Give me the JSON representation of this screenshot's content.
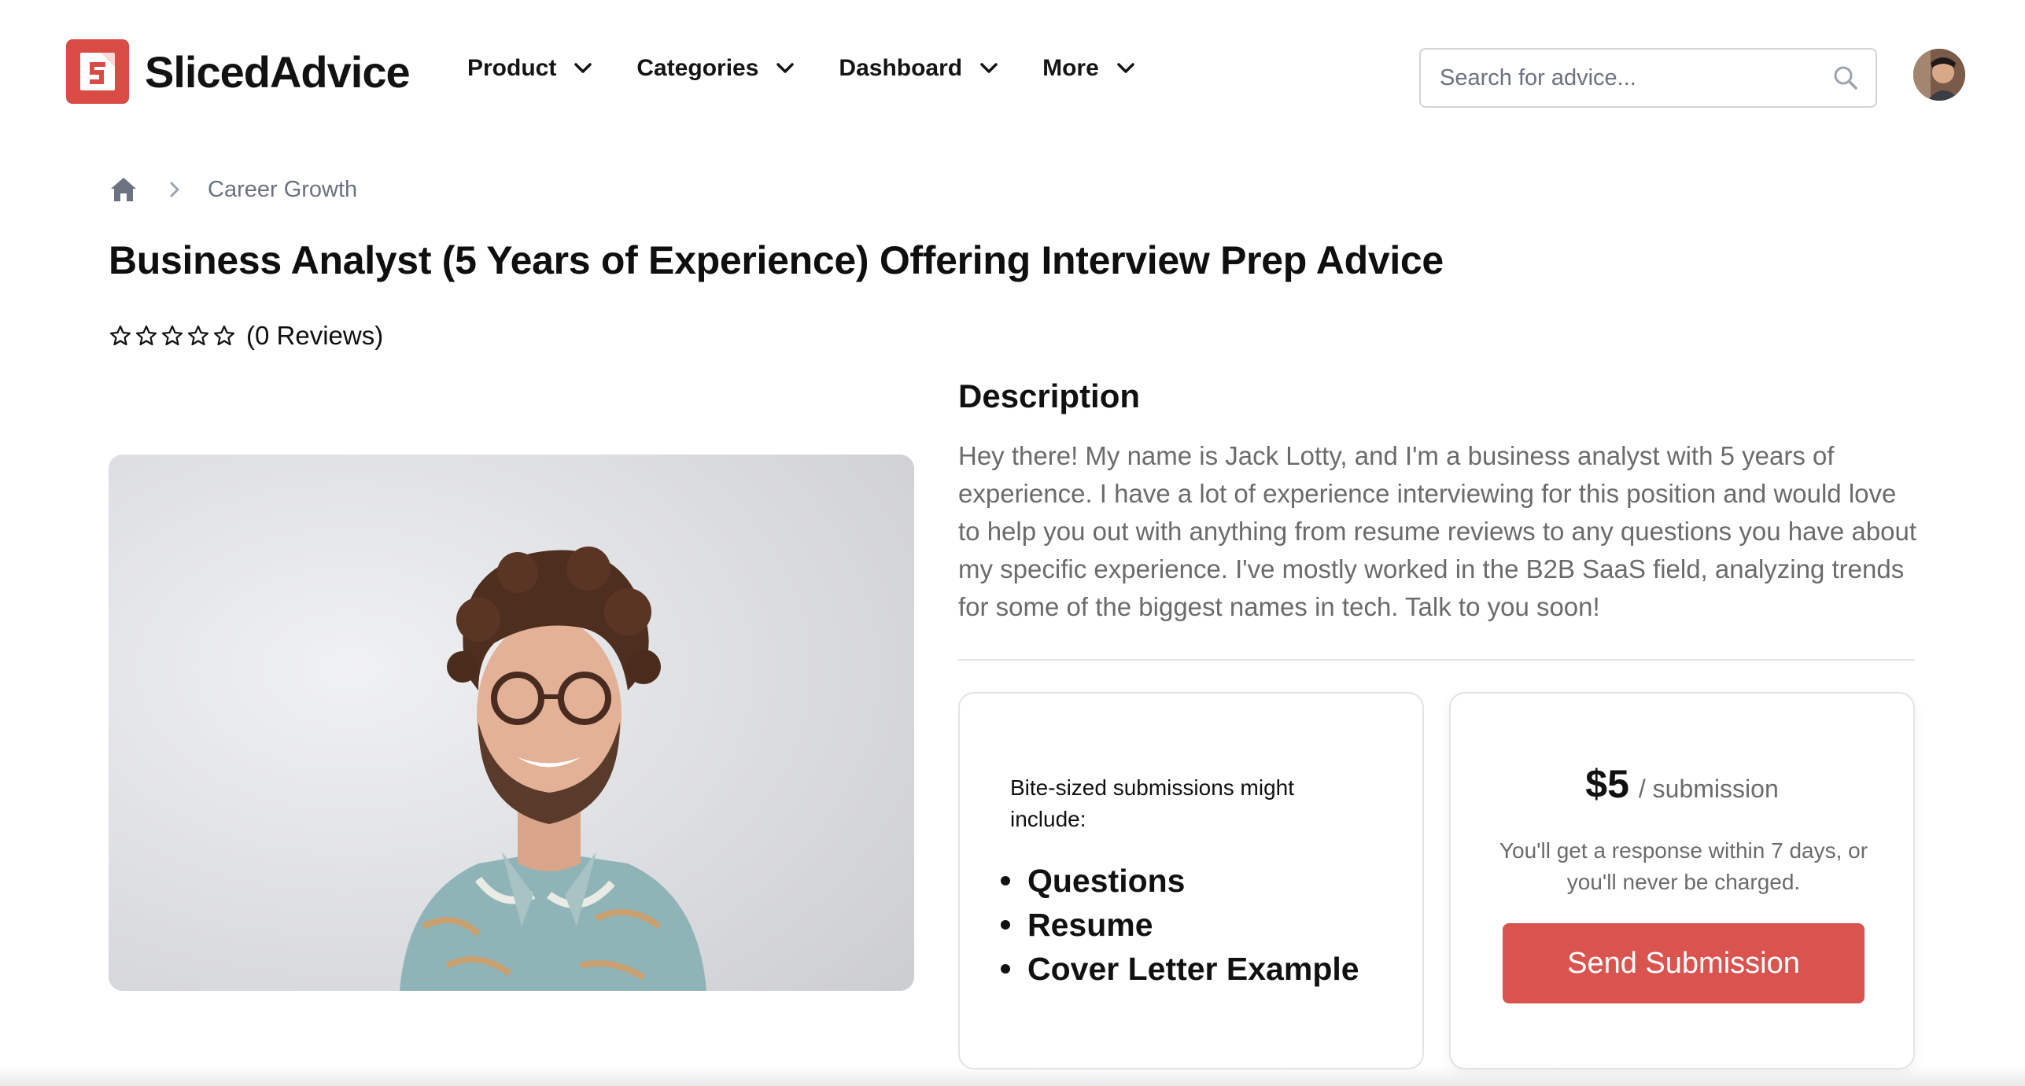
{
  "brand": {
    "name": "SlicedAdvice",
    "accent": "#d94b45"
  },
  "nav": {
    "items": [
      {
        "label": "Product"
      },
      {
        "label": "Categories"
      },
      {
        "label": "Dashboard"
      },
      {
        "label": "More"
      }
    ]
  },
  "search": {
    "placeholder": "Search for advice...",
    "value": ""
  },
  "breadcrumb": {
    "current": "Career Growth"
  },
  "listing": {
    "title": "Business Analyst (5 Years of Experience) Offering Interview Prep Advice",
    "rating": {
      "stars_filled": 0,
      "stars_total": 5,
      "reviews_text": "(0 Reviews)"
    },
    "description_title": "Description",
    "description": "Hey there! My name is Jack Lotty, and I'm a business analyst with 5 years of experience. I have a lot of experience interviewing for this position and would love to help you out with anything from resume reviews to any questions you have about my specific experience. I've mostly worked in the B2B SaaS field, analyzing trends for some of the biggest names in tech. Talk to you soon!"
  },
  "includes": {
    "label": "Bite-sized submissions might include:",
    "items": [
      "Questions",
      "Resume",
      "Cover Letter Example"
    ]
  },
  "pricing": {
    "price": "$5",
    "unit": "/ submission",
    "guarantee": "You'll get a response within 7 days, or you'll never be charged.",
    "button_label": "Send Submission",
    "button_color": "#d9534f"
  }
}
